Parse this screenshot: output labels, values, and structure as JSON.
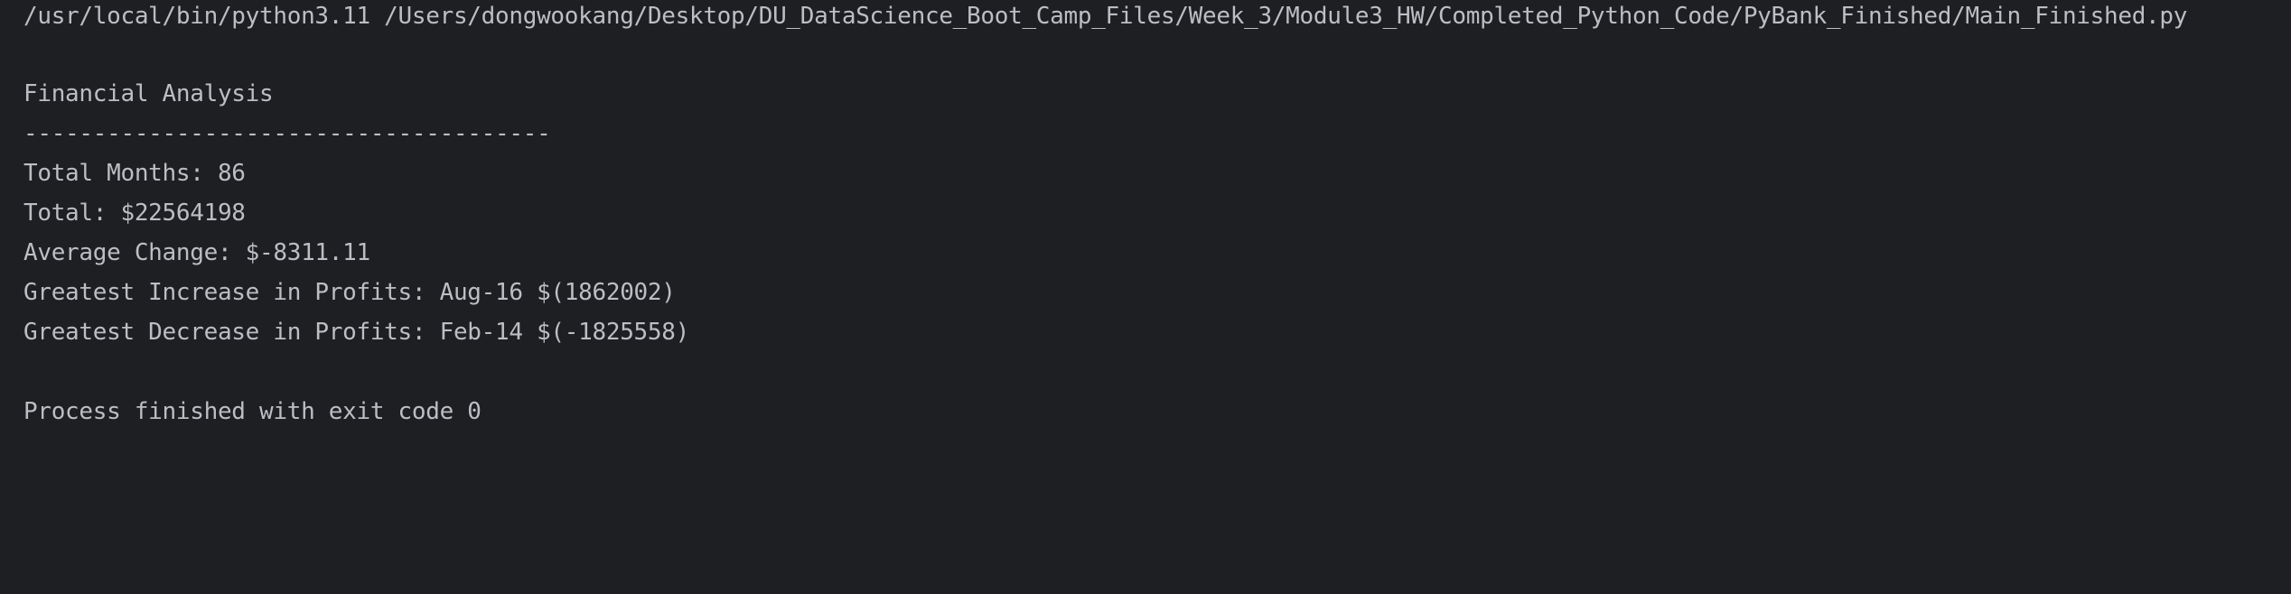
{
  "console": {
    "command": "/usr/local/bin/python3.11 /Users/dongwookang/Desktop/DU_DataScience_Boot_Camp_Files/Week_3/Module3_HW/Completed_Python_Code/PyBank_Finished/Main_Finished.py",
    "output": {
      "title": "Financial Analysis",
      "separator": "--------------------------------------",
      "total_months": "Total Months: 86",
      "total": "Total: $22564198",
      "average_change": "Average Change: $-8311.11",
      "greatest_increase": "Greatest Increase in Profits: Aug-16 $(1862002)",
      "greatest_decrease": "Greatest Decrease in Profits: Feb-14 $(-1825558)"
    },
    "exit_message": "Process finished with exit code 0"
  },
  "colors": {
    "background": "#1e1f22",
    "text": "#bcbec4"
  }
}
